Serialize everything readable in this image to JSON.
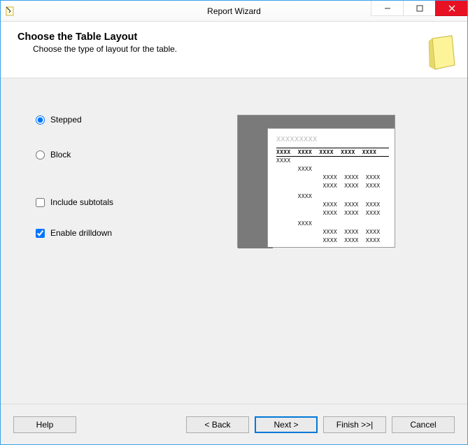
{
  "window": {
    "title": "Report Wizard"
  },
  "header": {
    "title": "Choose the Table Layout",
    "subtitle": "Choose the type of layout for the table."
  },
  "options": {
    "stepped_label": "Stepped",
    "block_label": "Block",
    "include_subtotals_label": "Include subtotals",
    "enable_drilldown_label": "Enable drilldown",
    "selected_layout": "stepped",
    "include_subtotals": false,
    "enable_drilldown": true
  },
  "buttons": {
    "help": "Help",
    "back": "< Back",
    "next": "Next >",
    "finish": "Finish >>|",
    "cancel": "Cancel"
  }
}
